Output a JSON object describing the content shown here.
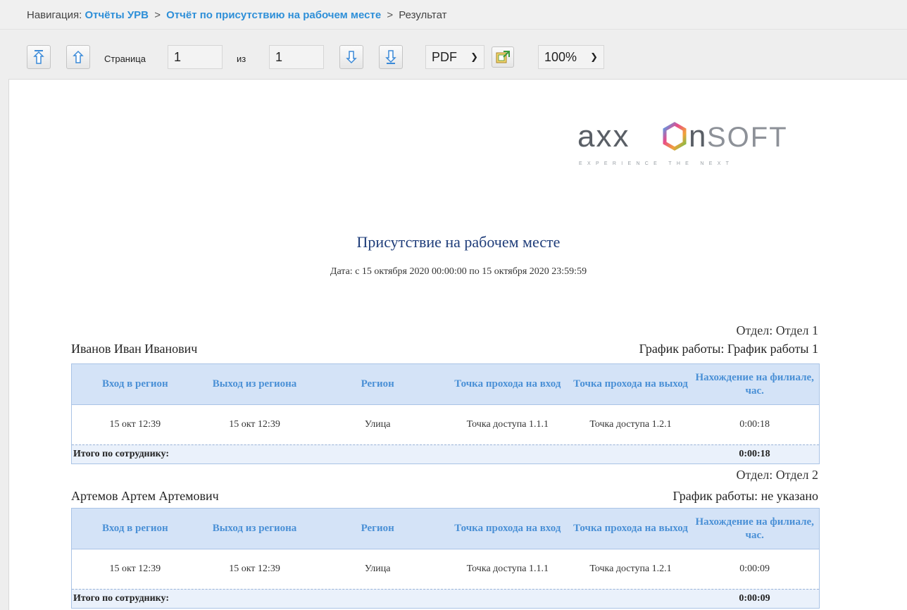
{
  "nav": {
    "prefix": "Навигация:",
    "crumb1": "Отчёты УРВ",
    "crumb2": "Отчёт по присутствию на рабочем месте",
    "current": "Результат",
    "sep": ">"
  },
  "toolbar": {
    "page_label": "Страница",
    "page_value": "1",
    "of_label": "из",
    "total_pages": "1",
    "format": "PDF",
    "zoom": "100%"
  },
  "logo": {
    "brand": "axxonsoft",
    "tagline": "EXPERIENCE THE NEXT"
  },
  "report": {
    "title": "Присутствие на рабочем месте",
    "date": "Дата: с 15 октября 2020 00:00:00 по 15 октября 2020 23:59:59",
    "columns": [
      "Вход в регион",
      "Выход из региона",
      "Регион",
      "Точка прохода на вход",
      "Точка прохода на выход",
      "Нахождение на филиале, час."
    ],
    "total_label": "Итого по сотруднику:",
    "employees": [
      {
        "dept": "Отдел: Отдел 1",
        "name": "Иванов Иван Иванович",
        "schedule": "График работы: График работы 1",
        "row": [
          "15 окт 12:39",
          "15 окт 12:39",
          "Улица",
          "Точка доступа 1.1.1",
          "Точка доступа 1.2.1",
          "0:00:18"
        ],
        "total": "0:00:18"
      },
      {
        "dept": "Отдел: Отдел 2",
        "name": "Артемов Артем Артемович",
        "schedule": "График работы: не указано",
        "row": [
          "15 окт 12:39",
          "15 окт 12:39",
          "Улица",
          "Точка доступа 1.1.1",
          "Точка доступа 1.2.1",
          "0:00:09"
        ],
        "total": "0:00:09"
      }
    ]
  },
  "colors": {
    "link": "#2e8fd8",
    "header_bg": "#d4e3f7",
    "header_text": "#4a90d6",
    "title": "#1f3d7a"
  }
}
